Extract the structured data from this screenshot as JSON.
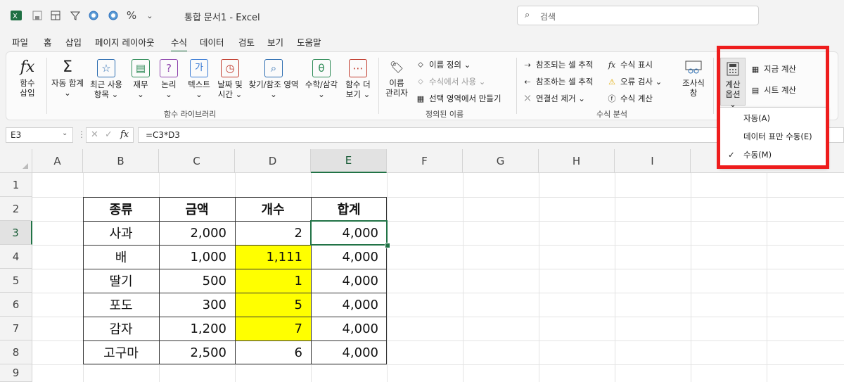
{
  "titlebar": {
    "doc_title": "통합 문서1  -  Excel",
    "search_placeholder": "검색",
    "qat_percent": "%"
  },
  "menu": [
    "파일",
    "홈",
    "삽입",
    "페이지 레이아웃",
    "수식",
    "데이터",
    "검토",
    "보기",
    "도움말"
  ],
  "menu_active": "수식",
  "ribbon": {
    "insert_function": [
      "함수",
      "삽입"
    ],
    "library": [
      {
        "label": [
          "자동 합계",
          "⌄"
        ],
        "icon": "Σ"
      },
      {
        "label": [
          "최근 사용",
          "항목 ⌄"
        ],
        "icon": "☆"
      },
      {
        "label": [
          "재무",
          "⌄"
        ],
        "icon": "▤"
      },
      {
        "label": [
          "논리",
          "⌄"
        ],
        "icon": "?"
      },
      {
        "label": [
          "텍스트",
          "⌄"
        ],
        "icon": "가"
      },
      {
        "label": [
          "날짜 및",
          "시간 ⌄"
        ],
        "icon": "◷"
      },
      {
        "label": [
          "찾기/참조 영역",
          "⌄"
        ],
        "icon": "⌕"
      },
      {
        "label": [
          "수학/삼각",
          "⌄"
        ],
        "icon": "θ"
      },
      {
        "label": [
          "함수 더",
          "보기 ⌄"
        ],
        "icon": "⋯"
      }
    ],
    "library_group": "함수 라이브러리",
    "name_manager": [
      "이름",
      "관리자"
    ],
    "define_name": "이름 정의  ⌄",
    "use_in_formula": "수식에서 사용  ⌄",
    "create_from_selection": "선택 영역에서 만들기",
    "defined_names_group": "정의된 이름",
    "trace_precedents": "참조되는 셀 추적",
    "trace_dependents": "참조하는 셀 추적",
    "remove_arrows": "연결선 제거  ⌄",
    "show_formulas": "수식 표시",
    "error_checking": "오류 검사  ⌄",
    "evaluate_formula": "수식 계산",
    "auditing_group": "수식 분석",
    "watch_window": [
      "조사식",
      "창"
    ],
    "calc_options": [
      "계산",
      "옵션 ⌄"
    ],
    "calc_now": "지금 계산",
    "calc_sheet": "시트 계산"
  },
  "dropdown": {
    "items": [
      "자동(A)",
      "데이터 표만 수동(E)",
      "수동(M)"
    ],
    "checked": "✓"
  },
  "formula_bar": {
    "name_box": "E3",
    "formula": "=C3*D3",
    "fx": "fx"
  },
  "columns": [
    "A",
    "B",
    "C",
    "D",
    "E",
    "F",
    "G",
    "H",
    "I"
  ],
  "rows": [
    "1",
    "2",
    "3",
    "4",
    "5",
    "6",
    "7",
    "8",
    "9"
  ],
  "selected_cell": "E3",
  "table": {
    "headers": [
      "종류",
      "금액",
      "개수",
      "합계"
    ],
    "rows": [
      [
        "사과",
        "2,000",
        "2",
        "4,000"
      ],
      [
        "배",
        "1,000",
        "1,111",
        "4,000"
      ],
      [
        "딸기",
        "500",
        "1",
        "4,000"
      ],
      [
        "포도",
        "300",
        "5",
        "4,000"
      ],
      [
        "감자",
        "1,200",
        "7",
        "4,000"
      ],
      [
        "고구마",
        "2,500",
        "6",
        "4,000"
      ]
    ],
    "highlight_color": "#ffff00"
  },
  "colors": {
    "excel_green": "#217346",
    "highlight_box": "#ee1c1c"
  }
}
